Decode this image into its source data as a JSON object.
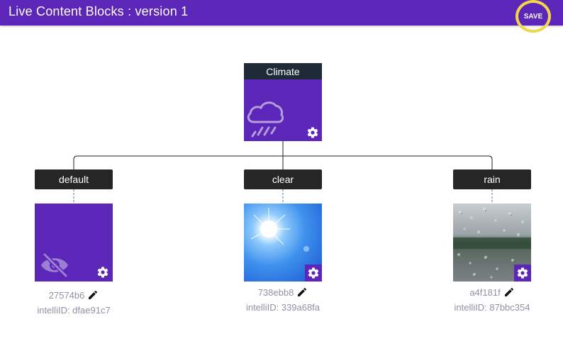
{
  "header": {
    "title": "Live Content Blocks : version 1",
    "save_label": "SAVE",
    "bar_color": "#5c27b9",
    "highlight_color": "#f2d54a"
  },
  "root": {
    "label": "Climate",
    "icon": "rain-cloud-icon",
    "settings_icon": "gear-icon"
  },
  "variants": [
    {
      "label": "default",
      "image": "hidden-eye-icon",
      "id": "27574b6",
      "intelli_id": "intelliID: dfae91c7"
    },
    {
      "label": "clear",
      "image": "sunny-sky-image",
      "id": "738ebb8",
      "intelli_id": "intelliID: 339a68fa"
    },
    {
      "label": "rain",
      "image": "raindrops-on-glass-image",
      "id": "a4f181f",
      "intelli_id": "intelliID: 87bbc354"
    }
  ]
}
